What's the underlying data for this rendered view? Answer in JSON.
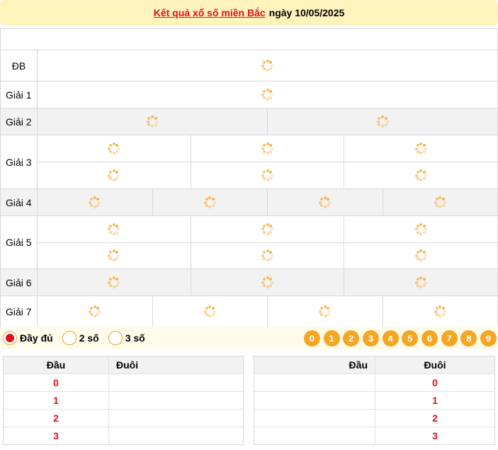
{
  "header": {
    "link_text": "Kết quả xổ số miền Bắc",
    "date_text": "ngày 10/05/2025"
  },
  "prizes": [
    {
      "label": "ĐB",
      "lines": [
        1
      ],
      "gray": false
    },
    {
      "label": "Giải 1",
      "lines": [
        1
      ],
      "gray": false
    },
    {
      "label": "Giải 2",
      "lines": [
        2
      ],
      "gray": true
    },
    {
      "label": "Giải 3",
      "lines": [
        3,
        3
      ],
      "gray": false
    },
    {
      "label": "Giải 4",
      "lines": [
        4
      ],
      "gray": true
    },
    {
      "label": "Giải 5",
      "lines": [
        3,
        3
      ],
      "gray": false
    },
    {
      "label": "Giải 6",
      "lines": [
        3
      ],
      "gray": true
    },
    {
      "label": "Giải 7",
      "lines": [
        4
      ],
      "gray": false
    }
  ],
  "options": [
    {
      "label": "Đầy đủ",
      "selected": true
    },
    {
      "label": "2 số",
      "selected": false
    },
    {
      "label": "3 số",
      "selected": false
    }
  ],
  "digits": [
    "0",
    "1",
    "2",
    "3",
    "4",
    "5",
    "6",
    "7",
    "8",
    "9"
  ],
  "table_left": {
    "col1": "Đầu",
    "col2": "Đuôi",
    "rows": [
      "0",
      "1",
      "2",
      "3"
    ]
  },
  "table_right": {
    "col1": "Đầu",
    "col2": "Đuôi",
    "rows": [
      "0",
      "1",
      "2",
      "3"
    ]
  },
  "colors": {
    "accent": "#f5a623",
    "red": "#e0101a",
    "header_bg": "#fff3bd"
  }
}
